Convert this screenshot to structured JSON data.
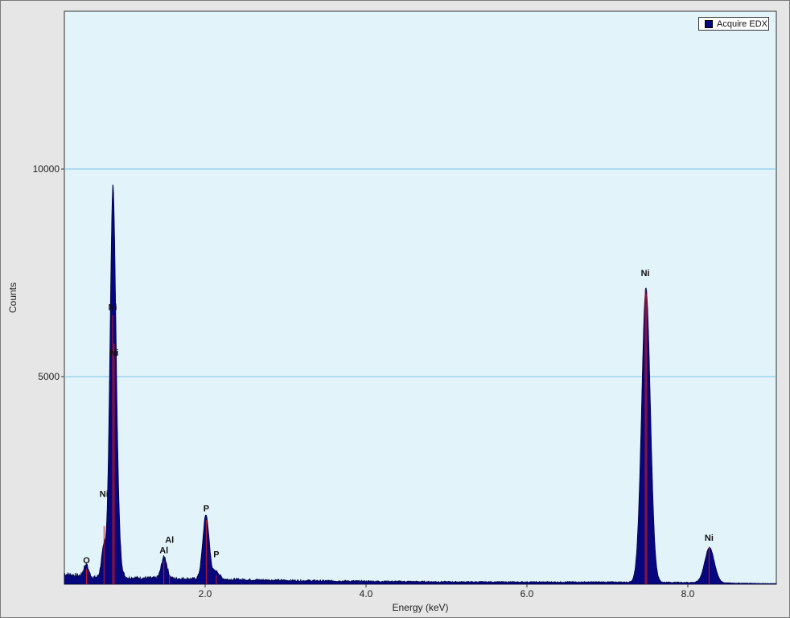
{
  "chart_data": {
    "type": "area",
    "title": "",
    "xlabel": "Energy (keV)",
    "ylabel": "Counts",
    "xlim": [
      0.25,
      9.1
    ],
    "ylim": [
      0,
      13800
    ],
    "x_ticks": [
      {
        "value": 2.0,
        "label": "2.0"
      },
      {
        "value": 4.0,
        "label": "4.0"
      },
      {
        "value": 6.0,
        "label": "6.0"
      },
      {
        "value": 8.0,
        "label": "8.0"
      }
    ],
    "y_ticks": [
      {
        "value": 5000,
        "label": "5000"
      },
      {
        "value": 10000,
        "label": "10000"
      }
    ],
    "grid": {
      "y": true,
      "x": false
    },
    "legend": {
      "position": "top-right",
      "entries": [
        "Acquire EDX"
      ]
    },
    "series": [
      {
        "name": "Acquire EDX",
        "color": "#06067e",
        "peaks": [
          {
            "center": 0.52,
            "height": 300,
            "width": 0.03
          },
          {
            "center": 0.74,
            "height": 700,
            "width": 0.03
          },
          {
            "center": 0.85,
            "height": 6500,
            "width": 0.035
          },
          {
            "center": 0.87,
            "height": 3200,
            "width": 0.045
          },
          {
            "center": 1.49,
            "height": 520,
            "width": 0.035
          },
          {
            "center": 2.01,
            "height": 1550,
            "width": 0.04
          },
          {
            "center": 2.14,
            "height": 180,
            "width": 0.04
          },
          {
            "center": 7.48,
            "height": 7100,
            "width": 0.055
          },
          {
            "center": 8.27,
            "height": 850,
            "width": 0.06
          }
        ],
        "background": [
          {
            "x": 0.25,
            "y": 250
          },
          {
            "x": 0.6,
            "y": 170
          },
          {
            "x": 1.1,
            "y": 160
          },
          {
            "x": 1.7,
            "y": 140
          },
          {
            "x": 2.3,
            "y": 120
          },
          {
            "x": 3.0,
            "y": 95
          },
          {
            "x": 4.0,
            "y": 75
          },
          {
            "x": 5.0,
            "y": 60
          },
          {
            "x": 6.0,
            "y": 55
          },
          {
            "x": 7.0,
            "y": 55
          },
          {
            "x": 8.0,
            "y": 45
          },
          {
            "x": 9.1,
            "y": 15
          }
        ]
      }
    ],
    "element_lines": [
      {
        "x": 0.525,
        "y": 360,
        "label": "O",
        "label_y": 500
      },
      {
        "x": 0.743,
        "y": 1400,
        "label": "Ni",
        "label_y": 2100
      },
      {
        "x": 0.851,
        "y": 6480,
        "label": "Ni",
        "label_y": 6600
      },
      {
        "x": 0.869,
        "y": 5800,
        "label": "Ni",
        "label_y": 5500
      },
      {
        "x": 1.487,
        "y": 560,
        "label": "Al",
        "label_y": 750
      },
      {
        "x": 1.557,
        "y": 200,
        "label": "Al",
        "label_y": 1000
      },
      {
        "x": 2.014,
        "y": 1550,
        "label": "P",
        "label_y": 1750
      },
      {
        "x": 2.139,
        "y": 220,
        "label": "P",
        "label_y": 650
      },
      {
        "x": 7.471,
        "y": 7100,
        "label": "Ni",
        "label_y": 7420
      },
      {
        "x": 7.489,
        "y": 7000,
        "label": "",
        "label_y": 0
      },
      {
        "x": 8.264,
        "y": 900,
        "label": "Ni",
        "label_y": 1050
      }
    ]
  }
}
